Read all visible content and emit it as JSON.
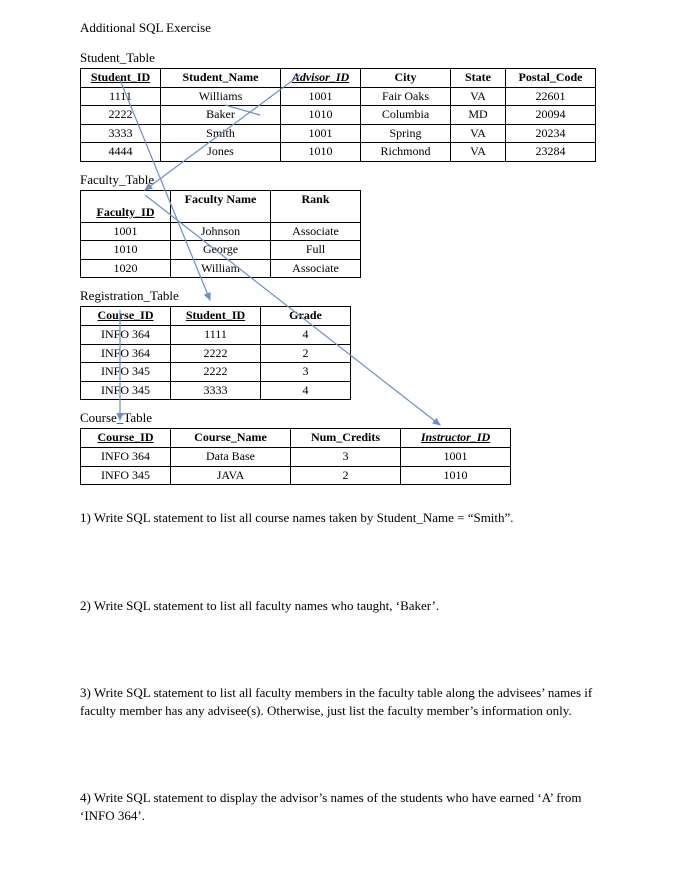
{
  "title": "Additional SQL Exercise",
  "tables": {
    "student": {
      "label": "Student_Table",
      "headers": [
        "Student_ID",
        "Student_Name",
        "Advisor_ID",
        "City",
        "State",
        "Postal_Code"
      ],
      "rows": [
        [
          "1111",
          "Williams",
          "1001",
          "Fair Oaks",
          "VA",
          "22601"
        ],
        [
          "2222",
          "Baker",
          "1010",
          "Columbia",
          "MD",
          "20094"
        ],
        [
          "3333",
          "Smith",
          "1001",
          "Spring",
          "VA",
          "20234"
        ],
        [
          "4444",
          "Jones",
          "1010",
          "Richmond",
          "VA",
          "23284"
        ]
      ]
    },
    "faculty": {
      "label": "Faculty_Table",
      "headers": [
        "Faculty_ID",
        "Faculty Name",
        "Rank"
      ],
      "rows": [
        [
          "1001",
          "Johnson",
          "Associate"
        ],
        [
          "1010",
          "George",
          "Full"
        ],
        [
          "1020",
          "William",
          "Associate"
        ]
      ]
    },
    "registration": {
      "label": "Registration_Table",
      "headers": [
        "Course_ID",
        "Student_ID",
        "Grade"
      ],
      "rows": [
        [
          "INFO 364",
          "1111",
          "4"
        ],
        [
          "INFO 364",
          "2222",
          "2"
        ],
        [
          "INFO 345",
          "2222",
          "3"
        ],
        [
          "INFO 345",
          "3333",
          "4"
        ]
      ]
    },
    "course": {
      "label": "Course_Table",
      "headers": [
        "Course_ID",
        "Course_Name",
        "Num_Credits",
        "Instructor_ID"
      ],
      "rows": [
        [
          "INFO 364",
          "Data Base",
          "3",
          "1001"
        ],
        [
          "INFO 345",
          "JAVA",
          "2",
          "1010"
        ]
      ]
    }
  },
  "questions": {
    "q1": "1)    Write SQL statement to list all course names taken by Student_Name = “Smith”.",
    "q2": "2) Write SQL statement to list all faculty names who taught, ‘Baker’.",
    "q3": "3) Write SQL statement to list all faculty members in the faculty table along the advisees’ names if faculty member has any advisee(s). Otherwise, just list the faculty member’s information only.",
    "q4": "4) Write SQL statement to display the advisor’s names of the students who have earned ‘A’ from ‘INFO 364’."
  }
}
